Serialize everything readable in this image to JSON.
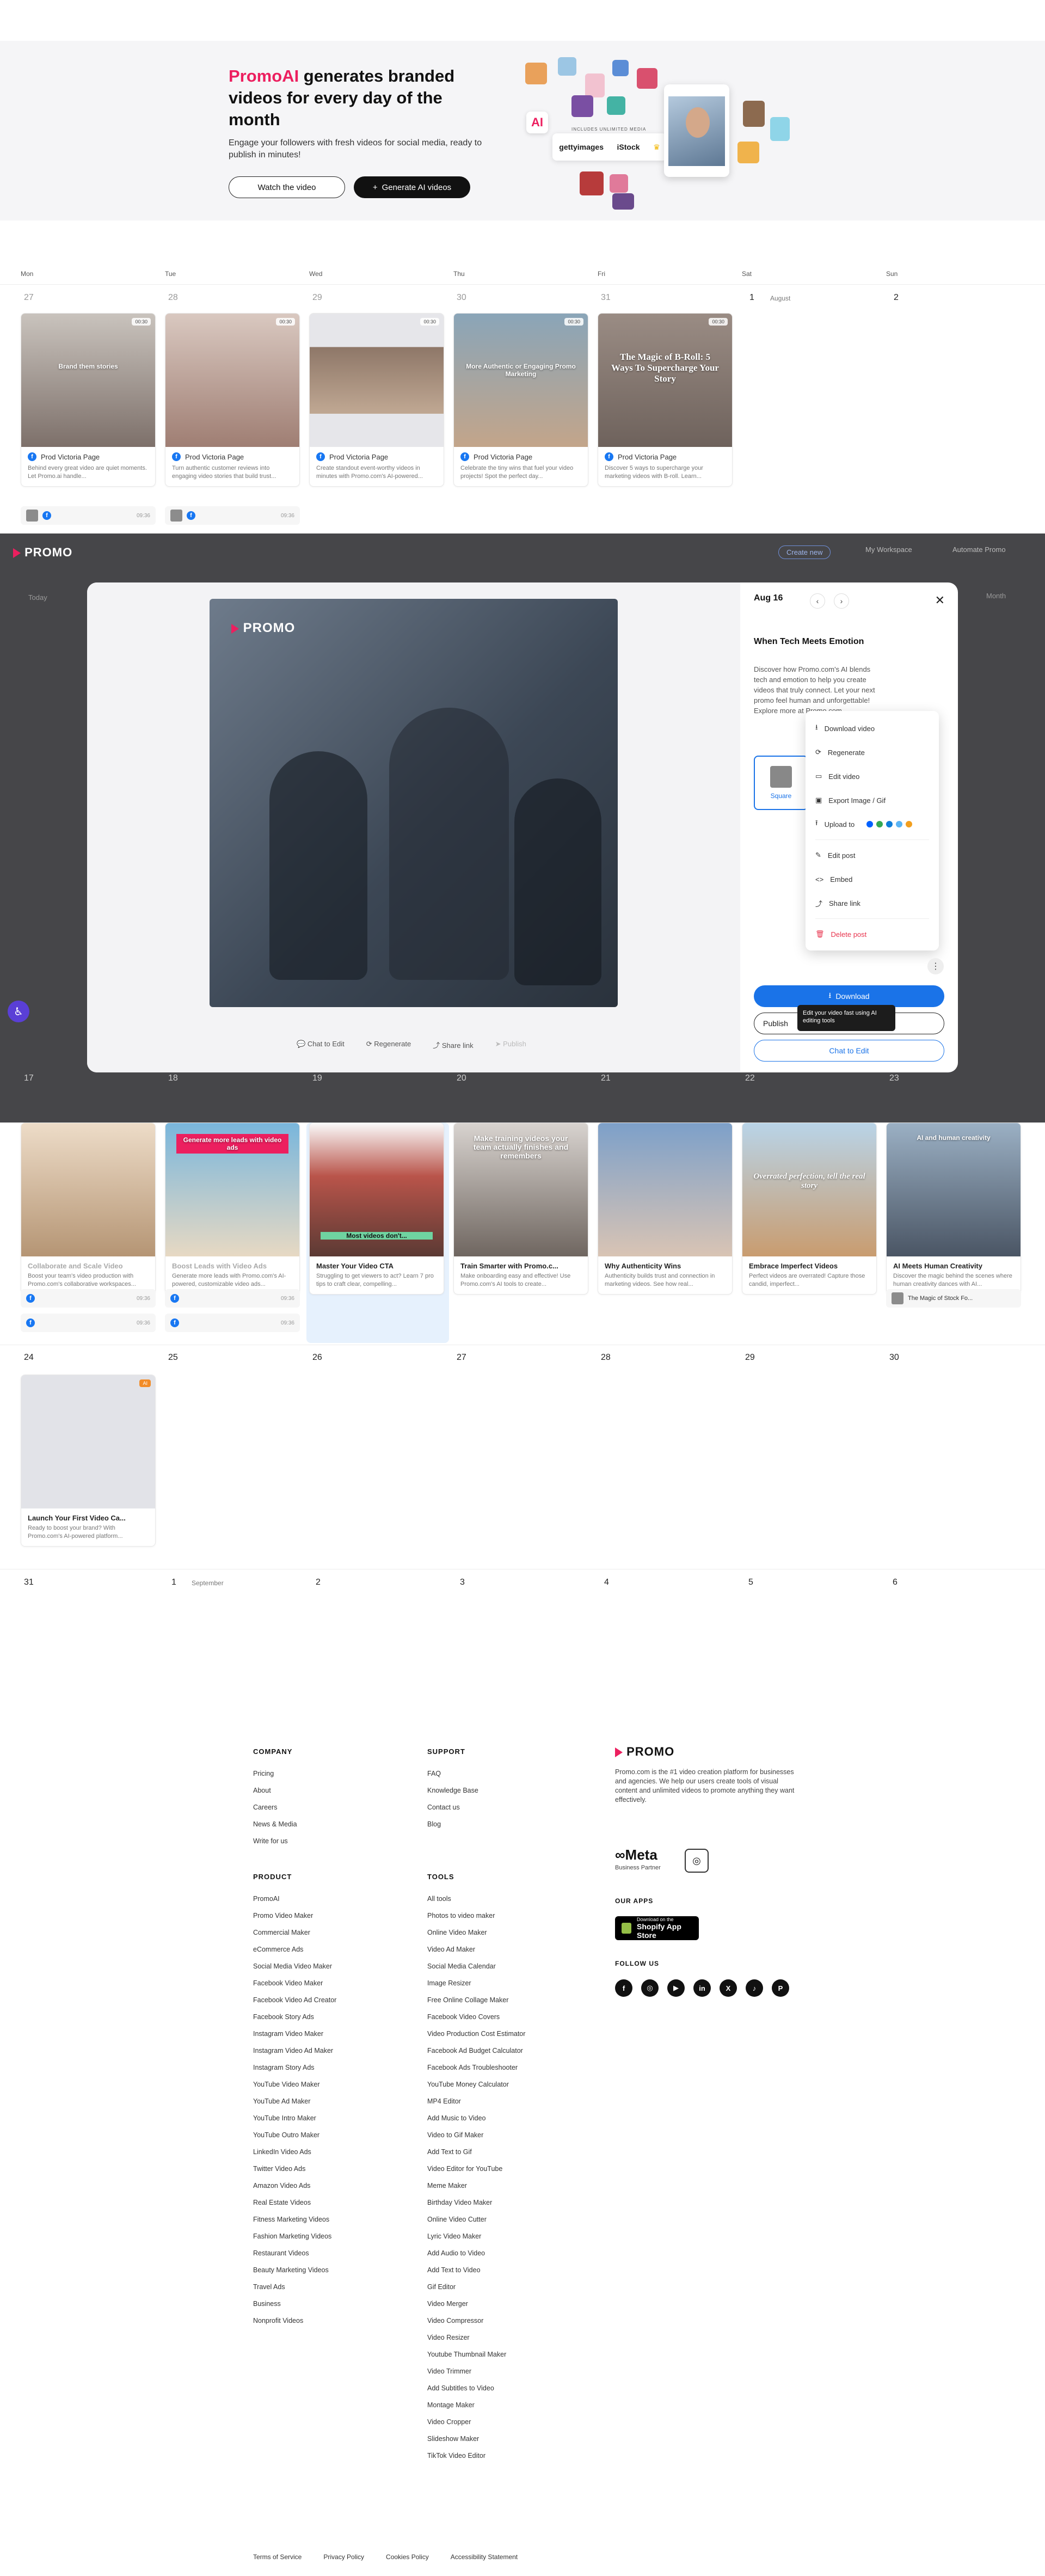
{
  "hero": {
    "title_brand": "PromoAI",
    "title_rest": " generates branded videos for every day of the month",
    "subtitle": "Engage your followers with fresh videos for social media, ready to publish in minutes!",
    "watch_label": "Watch the video",
    "generate_label": "Generate AI videos",
    "getty_note": "INCLUDES UNLIMITED MEDIA",
    "getty_label": "gettyimages",
    "istock_label": "iStock",
    "ai_badge": "AI"
  },
  "calendar": {
    "weekdays": [
      "Mon",
      "Tue",
      "Wed",
      "Thu",
      "Fri",
      "Sat",
      "Sun"
    ],
    "week1": {
      "days": [
        "27",
        "28",
        "29",
        "30",
        "31",
        "1",
        "2"
      ],
      "month_label": "August",
      "cards": [
        {
          "caption": "Brand them stories",
          "tag": "00:30",
          "page": "Prod Victoria Page",
          "desc": "Behind every great video are quiet moments. Let Promo.ai handle...",
          "time": "09:36"
        },
        {
          "caption": "",
          "tag": "00:30",
          "page": "Prod Victoria Page",
          "desc": "Turn authentic customer reviews into engaging video stories that build trust...",
          "time": "09:36"
        },
        {
          "caption": "",
          "tag": "00:30",
          "page": "Prod Victoria Page",
          "desc": "Create standout event-worthy videos in minutes with Promo.com's AI-powered...",
          "time": ""
        },
        {
          "caption": "More Authentic or Engaging Promo Marketing",
          "tag": "00:30",
          "page": "Prod Victoria Page",
          "desc": "Celebrate the tiny wins that fuel your video projects! Spot the perfect day...",
          "time": ""
        },
        {
          "caption": "The Magic of B-Roll: 5 Ways To Supercharge Your Story",
          "tag": "00:30",
          "page": "Prod Victoria Page",
          "desc": "Discover 5 ways to supercharge your marketing videos with B-roll. Learn...",
          "time": ""
        }
      ]
    },
    "week3": {
      "days": [
        "17",
        "18",
        "19",
        "20",
        "21",
        "22",
        "23"
      ],
      "cards": [
        {
          "title": "Collaborate and Scale Video",
          "desc": "Boost your team's video production with Promo.com's collaborative workspaces...",
          "time": "09:36",
          "caption": ""
        },
        {
          "title": "Boost Leads with Video Ads",
          "desc": "Generate more leads with Promo.com's AI-powered, customizable video ads...",
          "time": "09:36",
          "caption": "Generate more leads with video ads"
        },
        {
          "title": "Master Your Video CTA",
          "desc": "Struggling to get viewers to act? Learn 7 pro tips to craft clear, compelling...",
          "time": "",
          "caption": "Most videos don't..."
        },
        {
          "title": "Train Smarter with Promo.c...",
          "desc": "Make onboarding easy and effective! Use Promo.com's AI tools to create...",
          "time": "",
          "caption": "Make training videos your team actually finishes and remembers"
        },
        {
          "title": "Why Authenticity Wins",
          "desc": "Authenticity builds trust and connection in marketing videos. See how real...",
          "time": "",
          "caption": ""
        },
        {
          "title": "Embrace Imperfect Videos",
          "desc": "Perfect videos are overrated! Capture those candid, imperfect...",
          "time": "",
          "caption": "Overrated perfection, tell the real story"
        },
        {
          "title": "AI Meets Human Creativity",
          "desc": "Discover the magic behind the scenes where human creativity dances with AI...",
          "time": "",
          "caption": "AI and human creativity",
          "foot": "The Magic of Stock Fo..."
        }
      ]
    },
    "week4": {
      "days": [
        "24",
        "25",
        "26",
        "27",
        "28",
        "29",
        "30"
      ],
      "card": {
        "title": "Launch Your First Video Ca...",
        "desc": "Ready to boost your brand? With Promo.com's AI-powered platform...",
        "tag": "AI"
      }
    },
    "week5": {
      "days": [
        "31",
        "1",
        "2",
        "3",
        "4",
        "5",
        "6"
      ],
      "month_label": "September"
    }
  },
  "app_bar": {
    "logo": "PROMO",
    "create_label": "Create new",
    "workspace_label": "My Workspace",
    "automate_label": "Automate Promo",
    "today_label": "Today",
    "month_label": "Month"
  },
  "modal": {
    "date": "Aug 16",
    "video_logo": "PROMO",
    "post_title": "When Tech Meets Emotion",
    "post_body": "Discover how Promo.com's AI blends tech and emotion to help you create videos that truly connect. Let your next promo feel human and unforgettable! Explore more at Promo.com.",
    "format_label": "Square",
    "menu": [
      "Download video",
      "Regenerate",
      "Edit video",
      "Export Image / Gif",
      "Upload to",
      "Edit post",
      "Embed",
      "Share link",
      "Delete post"
    ],
    "download_label": "Download",
    "publish_label": "Publish",
    "tooltip": "Edit your video fast using AI editing tools",
    "chat_label": "Chat to Edit",
    "actions": [
      "Chat to Edit",
      "Regenerate",
      "Share link",
      "Publish"
    ]
  },
  "footer": {
    "company_h": "COMPANY",
    "company": [
      "Pricing",
      "About",
      "Careers",
      "News & Media",
      "Write for us"
    ],
    "support_h": "SUPPORT",
    "support": [
      "FAQ",
      "Knowledge Base",
      "Contact us",
      "Blog"
    ],
    "product_h": "PRODUCT",
    "product": [
      "PromoAI",
      "Promo Video Maker",
      "Commercial Maker",
      "eCommerce Ads",
      "Social Media Video Maker",
      "Facebook Video Maker",
      "Facebook Video Ad Creator",
      "Facebook Story Ads",
      "Instagram Video Maker",
      "Instagram Video Ad Maker",
      "Instagram Story Ads",
      "YouTube Video Maker",
      "YouTube Ad Maker",
      "YouTube Intro Maker",
      "YouTube Outro Maker",
      "LinkedIn Video Ads",
      "Twitter Video Ads",
      "Amazon Video Ads",
      "Real Estate Videos",
      "Fitness Marketing Videos",
      "Fashion Marketing Videos",
      "Restaurant Videos",
      "Beauty Marketing Videos",
      "Travel Ads",
      "Business",
      "Nonprofit Videos"
    ],
    "tools_h": "TOOLS",
    "tools": [
      "All tools",
      "Photos to video maker",
      "Online Video Maker",
      "Video Ad Maker",
      "Social Media Calendar",
      "Image Resizer",
      "Free Online Collage Maker",
      "Facebook Video Covers",
      "Video Production Cost Estimator",
      "Facebook Ad Budget Calculator",
      "Facebook Ads Troubleshooter",
      "YouTube Money Calculator",
      "MP4 Editor",
      "Add Music to Video",
      "Video to Gif Maker",
      "Add Text to Gif",
      "Video Editor for YouTube",
      "Meme Maker",
      "Birthday Video Maker",
      "Online Video Cutter",
      "Lyric Video Maker",
      "Add Audio to Video",
      "Add Text to Video",
      "Gif Editor",
      "Video Merger",
      "Video Compressor",
      "Video Resizer",
      "Youtube Thumbnail Maker",
      "Video Trimmer",
      "Add Subtitles to Video",
      "Montage Maker",
      "Video Cropper",
      "Slideshow Maker",
      "TikTok Video Editor"
    ],
    "brand_logo": "PROMO",
    "brand_desc": "Promo.com is the #1 video creation platform for businesses and agencies. We help our users create tools of visual content and unlimited videos to promote anything they want effectively.",
    "meta_logo": "Meta",
    "meta_sub": "Business Partner",
    "apps_h": "OUR APPS",
    "shopify_small": "Download on the",
    "shopify_big": "Shopify App Store",
    "follow_h": "FOLLOW US",
    "social": [
      "f",
      "◎",
      "▶",
      "in",
      "X",
      "♪",
      "P"
    ],
    "legal": [
      "Terms of Service",
      "Privacy Policy",
      "Cookies Policy",
      "Accessibility Statement"
    ]
  },
  "colors": {
    "brand_pink": "#ec1f5f",
    "accent_blue": "#1a73e8",
    "facebook_blue": "#1877f2",
    "danger": "#e8344e"
  }
}
